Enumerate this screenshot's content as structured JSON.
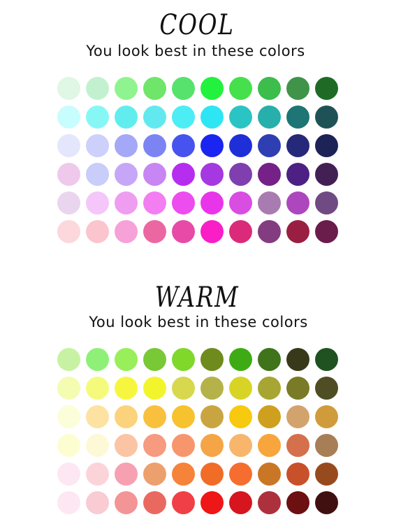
{
  "cool": {
    "heading": "COOL",
    "subtitle": "You look best in these colors",
    "rows": [
      [
        "#dff7e4",
        "#c3f1cf",
        "#8ff48f",
        "#6fe56a",
        "#57e26e",
        "#22f23d",
        "#45e04c",
        "#3cbd4c",
        "#3f9449",
        "#1f6b26"
      ],
      [
        "#c8fdfd",
        "#87f7f6",
        "#61eded",
        "#62e9ef",
        "#4cedf4",
        "#2ee5f4",
        "#2bc4c4",
        "#27afab",
        "#1d7575",
        "#1f5257"
      ],
      [
        "#e4e6fc",
        "#ccd0fb",
        "#a3a8f7",
        "#7c84f3",
        "#4653ee",
        "#1b25f1",
        "#1f2fd7",
        "#2e3fb3",
        "#26287a",
        "#1d2356"
      ],
      [
        "#eec9ec",
        "#c8cdf9",
        "#c6a6f6",
        "#c885f4",
        "#b62df0",
        "#a538e1",
        "#7f3faf",
        "#752188",
        "#4d2083",
        "#432054"
      ],
      [
        "#ead5ee",
        "#f4c6f9",
        "#ee9df1",
        "#f27ef2",
        "#ed4cee",
        "#e935e9",
        "#d94de2",
        "#a97cb1",
        "#ad47bd",
        "#704a82"
      ],
      [
        "#fcd7dc",
        "#fbc5cd",
        "#f6a1d7",
        "#eb67a2",
        "#e84aa8",
        "#f91ec6",
        "#dc2a7a",
        "#843c81",
        "#9a1e42",
        "#6a1c4a"
      ]
    ]
  },
  "warm": {
    "heading": "WARM",
    "subtitle": "You look best in these colors",
    "rows": [
      [
        "#c7f2a3",
        "#8ff078",
        "#98ef59",
        "#79c836",
        "#7fd82a",
        "#6f8b1d",
        "#3fab14",
        "#3f741b",
        "#38391a",
        "#1f5220"
      ],
      [
        "#f4fcb2",
        "#f5fa7c",
        "#f7f63f",
        "#f3f52c",
        "#d8d84f",
        "#b5b24a",
        "#d8d426",
        "#a8a632",
        "#797b26",
        "#4e4d24"
      ],
      [
        "#fcfed9",
        "#fde2a2",
        "#fbd37c",
        "#f9c03e",
        "#f6c22d",
        "#c9a542",
        "#f7c90f",
        "#cf9f1e",
        "#d3a36e",
        "#d09c3b"
      ],
      [
        "#fdfdd2",
        "#fdf9d6",
        "#fbc4a5",
        "#f69a80",
        "#f7966c",
        "#f5a546",
        "#f7b66c",
        "#f7a53c",
        "#d4704b",
        "#a77e56"
      ],
      [
        "#fde7f2",
        "#fbd4d9",
        "#f6a0b1",
        "#eca06e",
        "#f6833a",
        "#f06c27",
        "#f66d30",
        "#c97726",
        "#c8502a",
        "#984a1f"
      ],
      [
        "#fde7f2",
        "#f9cbd3",
        "#f39497",
        "#e96961",
        "#f03f46",
        "#ee1616",
        "#d6151e",
        "#ad313d",
        "#6c1012",
        "#401010"
      ]
    ]
  }
}
